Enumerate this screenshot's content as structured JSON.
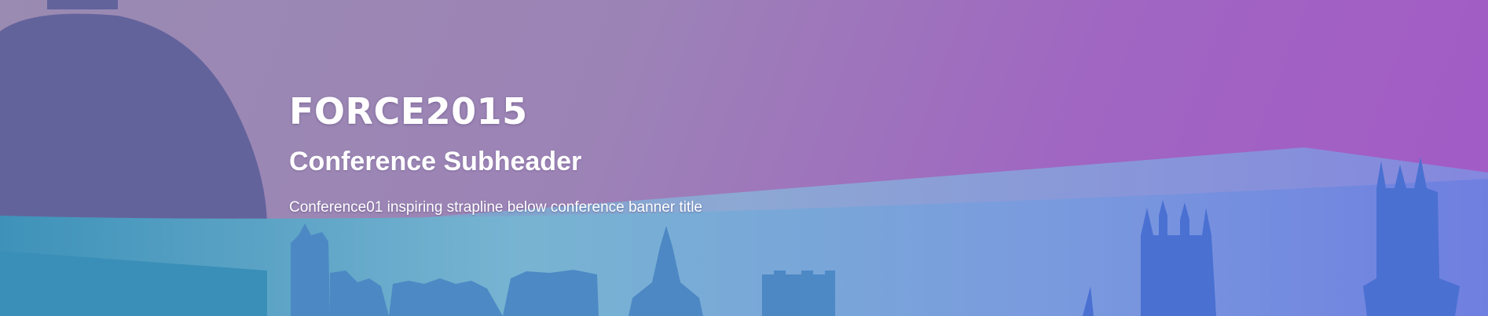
{
  "banner": {
    "title": "FORCE2015",
    "subheader": "Conference Subheader",
    "strapline": "Conference01 inspiring strapline below conference banner title"
  },
  "colors": {
    "gradient_left": "#9a8bb2",
    "gradient_right": "#a35ac6",
    "dome": "#63639c",
    "band_teal": "#3a8fb8",
    "band_light": "#7fa6dc",
    "tower_blue": "#4a6fd0",
    "text": "#ffffff"
  },
  "icons": {
    "background": "city-skyline-silhouette"
  }
}
